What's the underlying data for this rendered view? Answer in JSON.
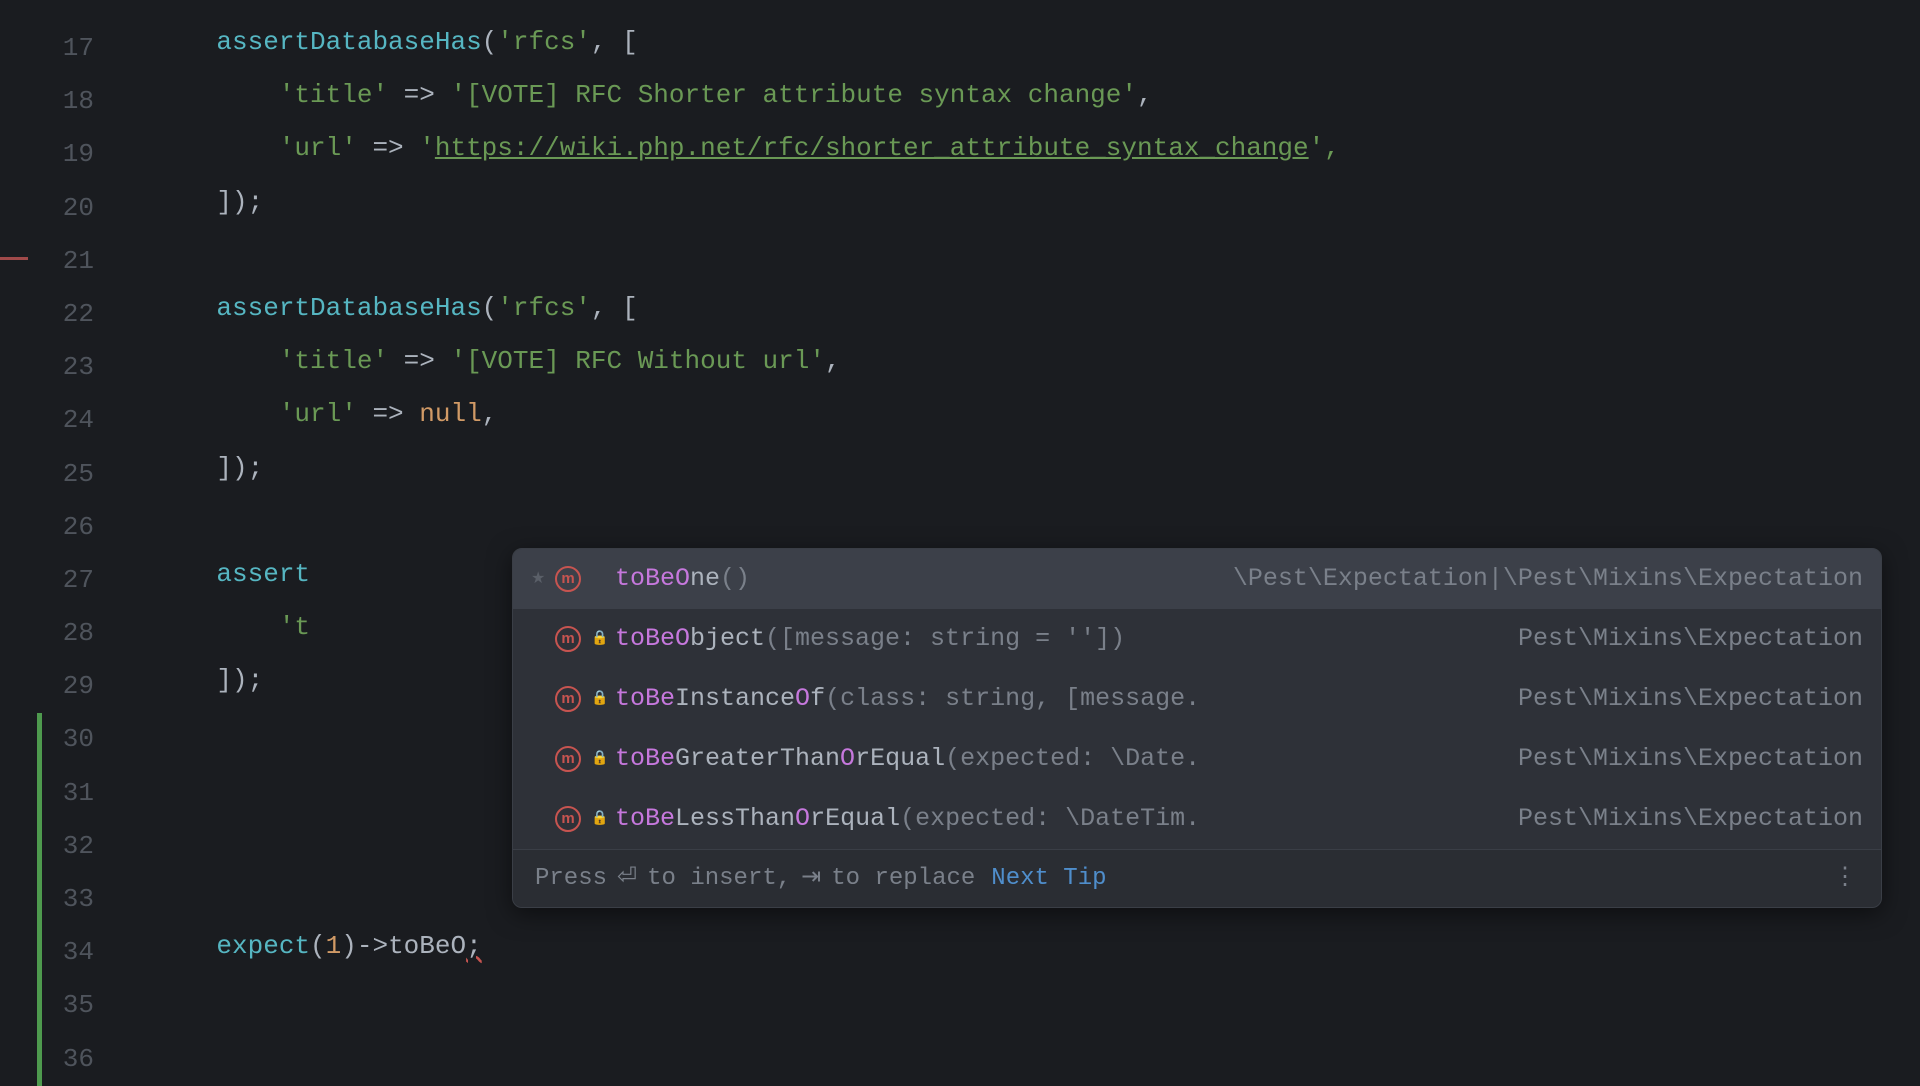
{
  "line_numbers": [
    "17",
    "18",
    "19",
    "20",
    "21",
    "22",
    "23",
    "24",
    "25",
    "26",
    "27",
    "28",
    "29",
    "30",
    "31",
    "32",
    "33",
    "34",
    "35",
    "36"
  ],
  "code": {
    "l17_fn": "assertDatabaseHas",
    "l17_arg": "'rfcs'",
    "l17_tail": ", [",
    "l18_key": "'title'",
    "l18_arrow": " => ",
    "l18_val": "'[VOTE] RFC Shorter attribute syntax change'",
    "l18_end": ",",
    "l19_key": "'url'",
    "l19_arrow": " => ",
    "l19_q": "'",
    "l19_url": "https://wiki.php.net/rfc/shorter_attribute_syntax_change",
    "l19_end": "',",
    "l20": "]);",
    "l22_fn": "assertDatabaseHas",
    "l22_arg": "'rfcs'",
    "l22_tail": ", [",
    "l23_key": "'title'",
    "l23_arrow": " => ",
    "l23_val": "'[VOTE] RFC Without url'",
    "l23_end": ",",
    "l24_key": "'url'",
    "l24_arrow": " => ",
    "l24_val": "null",
    "l24_end": ",",
    "l25": "]);",
    "l27_fn_frag": "assert",
    "l28_frag": "'t",
    "l29": "]);",
    "l34_expect": "expect",
    "l34_open": "(",
    "l34_num": "1",
    "l34_close_arrow": ")->",
    "l34_tobe": "toBeO",
    "l34_semi": ";"
  },
  "autocomplete": {
    "items": [
      {
        "match": "toBeO",
        "rest": "ne",
        "params": "()",
        "origin": "\\Pest\\Expectation|\\Pest\\Mixins\\Expectation",
        "star": true,
        "lock": false
      },
      {
        "match": "toBeO",
        "rest": "bject",
        "params": "([message: string = ''])",
        "origin": "Pest\\Mixins\\Expectation",
        "star": false,
        "lock": true
      },
      {
        "match": "toBe",
        "rest": "Instance",
        "match2": "O",
        "rest2": "f",
        "params": "(class: string, [message.",
        "origin": "Pest\\Mixins\\Expectation",
        "star": false,
        "lock": true
      },
      {
        "match": "toBe",
        "rest": "GreaterThan",
        "match2": "O",
        "rest2": "rEqual",
        "params": "(expected: \\Date.",
        "origin": "Pest\\Mixins\\Expectation",
        "star": false,
        "lock": true
      },
      {
        "match": "toBe",
        "rest": "LessThan",
        "match2": "O",
        "rest2": "rEqual",
        "params": "(expected: \\DateTim.",
        "origin": "Pest\\Mixins\\Expectation",
        "star": false,
        "lock": true
      }
    ],
    "footer_hint_1": "Press ",
    "footer_key_1": "⏎",
    "footer_hint_2": " to insert, ",
    "footer_key_2": "⇥",
    "footer_hint_3": " to replace",
    "footer_link": "Next Tip",
    "icon_letter": "m"
  }
}
